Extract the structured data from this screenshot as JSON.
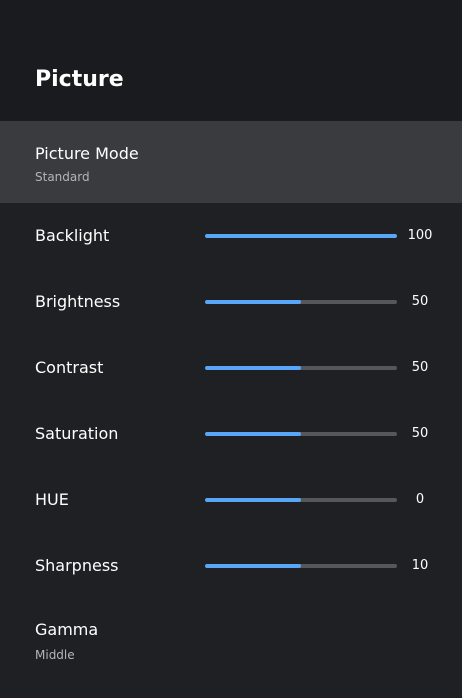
{
  "header": {
    "title": "Picture"
  },
  "picture_mode": {
    "label": "Picture Mode",
    "value": "Standard"
  },
  "sliders": [
    {
      "label": "Backlight",
      "value": "100",
      "level": 1.0
    },
    {
      "label": "Brightness",
      "value": "50",
      "level": 0.5
    },
    {
      "label": "Contrast",
      "value": "50",
      "level": 0.5
    },
    {
      "label": "Saturation",
      "value": "50",
      "level": 0.5
    },
    {
      "label": "HUE",
      "value": "0",
      "level": 0.5
    },
    {
      "label": "Sharpness",
      "value": "10",
      "level": 0.5
    }
  ],
  "gamma": {
    "label": "Gamma",
    "value": "Middle"
  },
  "colors": {
    "background": "#1f2023",
    "header_background": "#1a1b1e",
    "selected_row": "#3a3b3f",
    "accent": "#58a6f7",
    "track": "#55575c"
  }
}
